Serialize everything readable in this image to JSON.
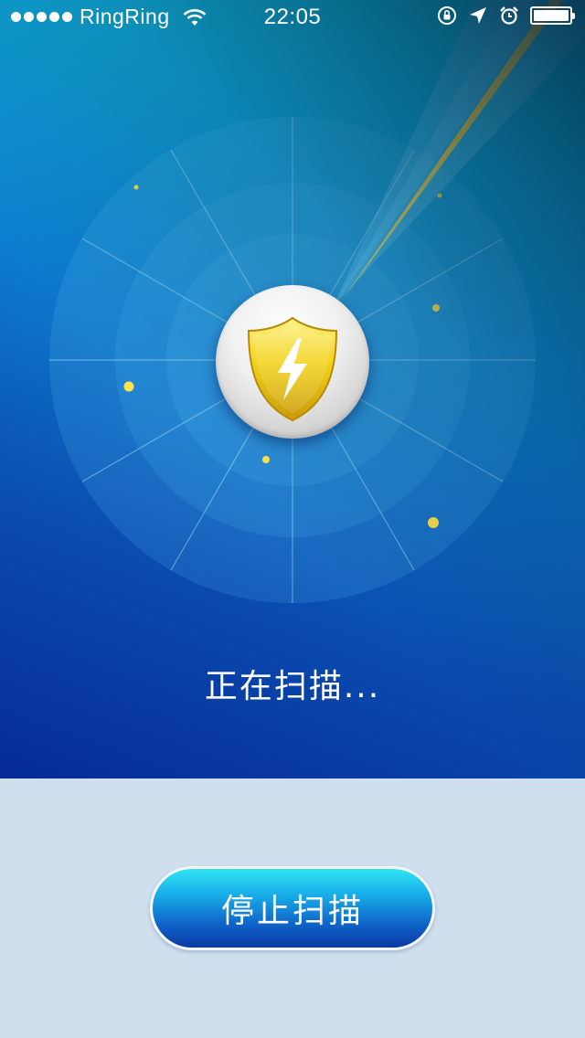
{
  "status_bar": {
    "carrier": "RingRing",
    "time": "22:05",
    "signal_bars": 5,
    "battery_level": 1.0
  },
  "scan": {
    "status_text": "正在扫描...",
    "stop_button_label": "停止扫描"
  },
  "colors": {
    "panel_top": "#10dcec",
    "panel_bottom": "#062b96",
    "lower_background": "#d0dfee",
    "beam_yellow": "#ffe24a",
    "shield_yellow": "#f1d21a",
    "dot_yellow": "#ffe34d"
  },
  "icons": {
    "status": [
      "wifi-icon",
      "orientation-lock-icon",
      "location-arrow-icon",
      "alarm-clock-icon",
      "battery-icon"
    ],
    "center": "shield-lightning-icon"
  }
}
